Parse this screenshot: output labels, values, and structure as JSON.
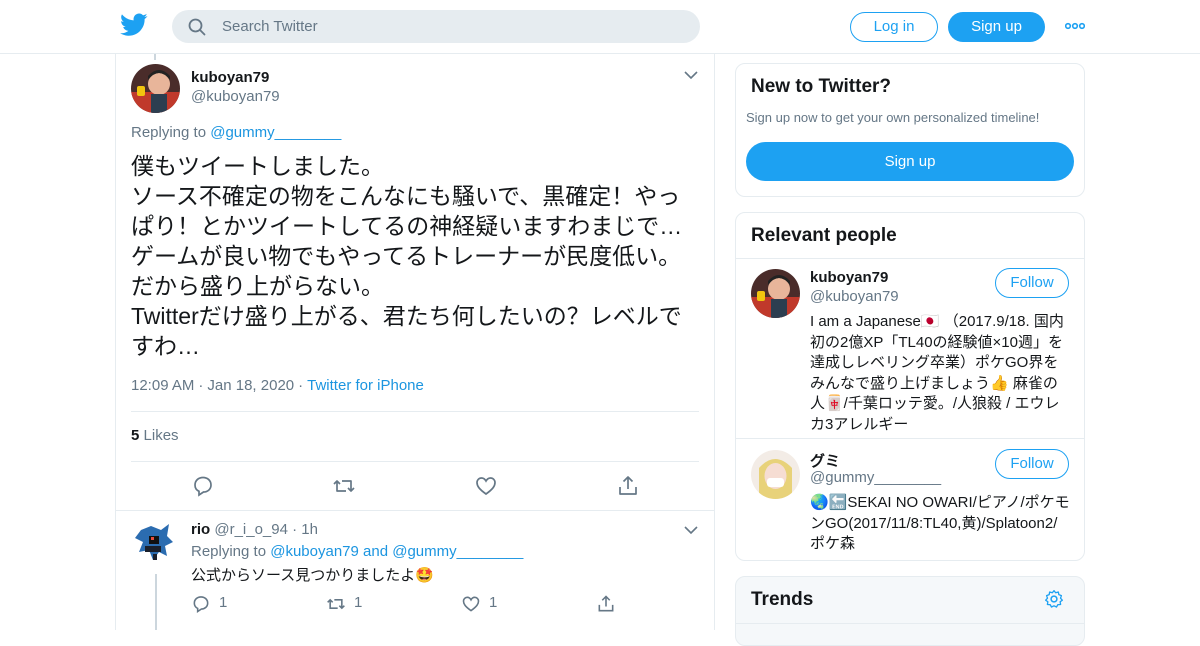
{
  "header": {
    "search_placeholder": "Search Twitter",
    "login_label": "Log in",
    "signup_label": "Sign up"
  },
  "tweet": {
    "name": "kuboyan79",
    "handle": "@kuboyan79",
    "replying_prefix": "Replying to ",
    "replying_to": "@gummy________",
    "text": "僕もツイートしました。\nソース不確定の物をこんなにも騒いで、黒確定！やっぱり！とかツイートしてるの神経疑いますわまじで…\nゲームが良い物でもやってるトレーナーが民度低い。\nだから盛り上がらない。\nTwitterだけ盛り上がる、君たち何したいの？レベルですわ…",
    "time": "12:09 AM",
    "date": "Jan 18, 2020",
    "source": "Twitter for iPhone",
    "likes_count": "5",
    "likes_label": "Likes"
  },
  "reply": {
    "name": "rio",
    "handle": "@r_i_o_94",
    "age": "1h",
    "replying_prefix": "Replying to ",
    "replying_to_1": "@kuboyan79",
    "replying_and": " and ",
    "replying_to_2": "@gummy________",
    "text": "公式からソース見つかりましたよ🤩",
    "reply_count": "1",
    "retweet_count": "1",
    "like_count": "1"
  },
  "sidebar": {
    "new_title": "New to Twitter?",
    "new_sub": "Sign up now to get your own personalized timeline!",
    "new_button": "Sign up",
    "relevant_title": "Relevant people",
    "people": [
      {
        "name": "kuboyan79",
        "handle": "@kuboyan79",
        "follow": "Follow",
        "bio": "I am a Japanese🇯🇵 （2017.9/18. 国内初の2億XP「TL40の経験値×10週」を達成しレベリング卒業）ポケGO界をみんなで盛り上げましょう👍 麻雀の人🀄/千葉ロッテ愛。/人狼殺 / エウレカ3アレルギー"
      },
      {
        "name": "グミ",
        "handle": "@gummy________",
        "follow": "Follow",
        "bio": "🌏🔚SEKAI NO OWARI/ピアノ/ポケモンGO(2017/11/8:TL40,黄)/Splatoon2/ポケ森"
      }
    ],
    "trends_title": "Trends"
  },
  "colors": {
    "brand": "#1da1f2",
    "link": "#1b95e0",
    "muted": "#657786",
    "border": "#e6ecf0"
  }
}
